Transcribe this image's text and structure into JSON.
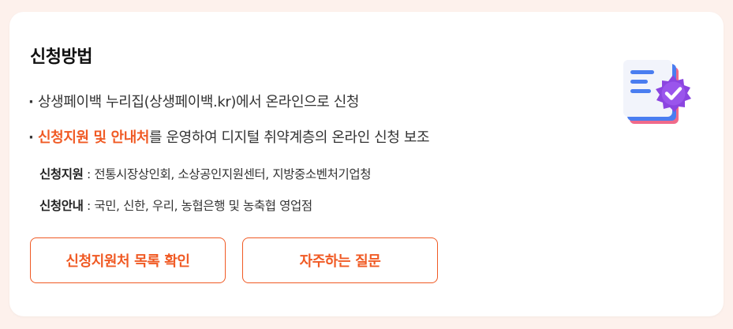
{
  "card": {
    "title": "신청방법",
    "bullets": [
      {
        "dot": "·",
        "highlight": "",
        "text": "상생페이백 누리집(상생페이백.kr)에서 온라인으로 신청"
      },
      {
        "dot": "·",
        "highlight": "신청지원 및 안내처",
        "text": "를 운영하여 디지털 취약계층의 온라인 신청 보조"
      }
    ],
    "details": [
      {
        "label": "신청지원",
        "text": " : 전통시장상인회, 소상공인지원센터, 지방중소벤처기업청"
      },
      {
        "label": "신청안내",
        "text": " : 국민, 신한, 우리, 농협은행 및 농축협 영업점"
      }
    ],
    "buttons": {
      "list_label": "신청지원처 목록 확인",
      "faq_label": "자주하는 질문"
    },
    "illustration_icon": "document-checkmark-badge-icon"
  },
  "colors": {
    "accent": "#f05a24",
    "page_background": "#fdf1ec",
    "card_background": "#ffffff",
    "badge_purple": "#8b45e0"
  }
}
